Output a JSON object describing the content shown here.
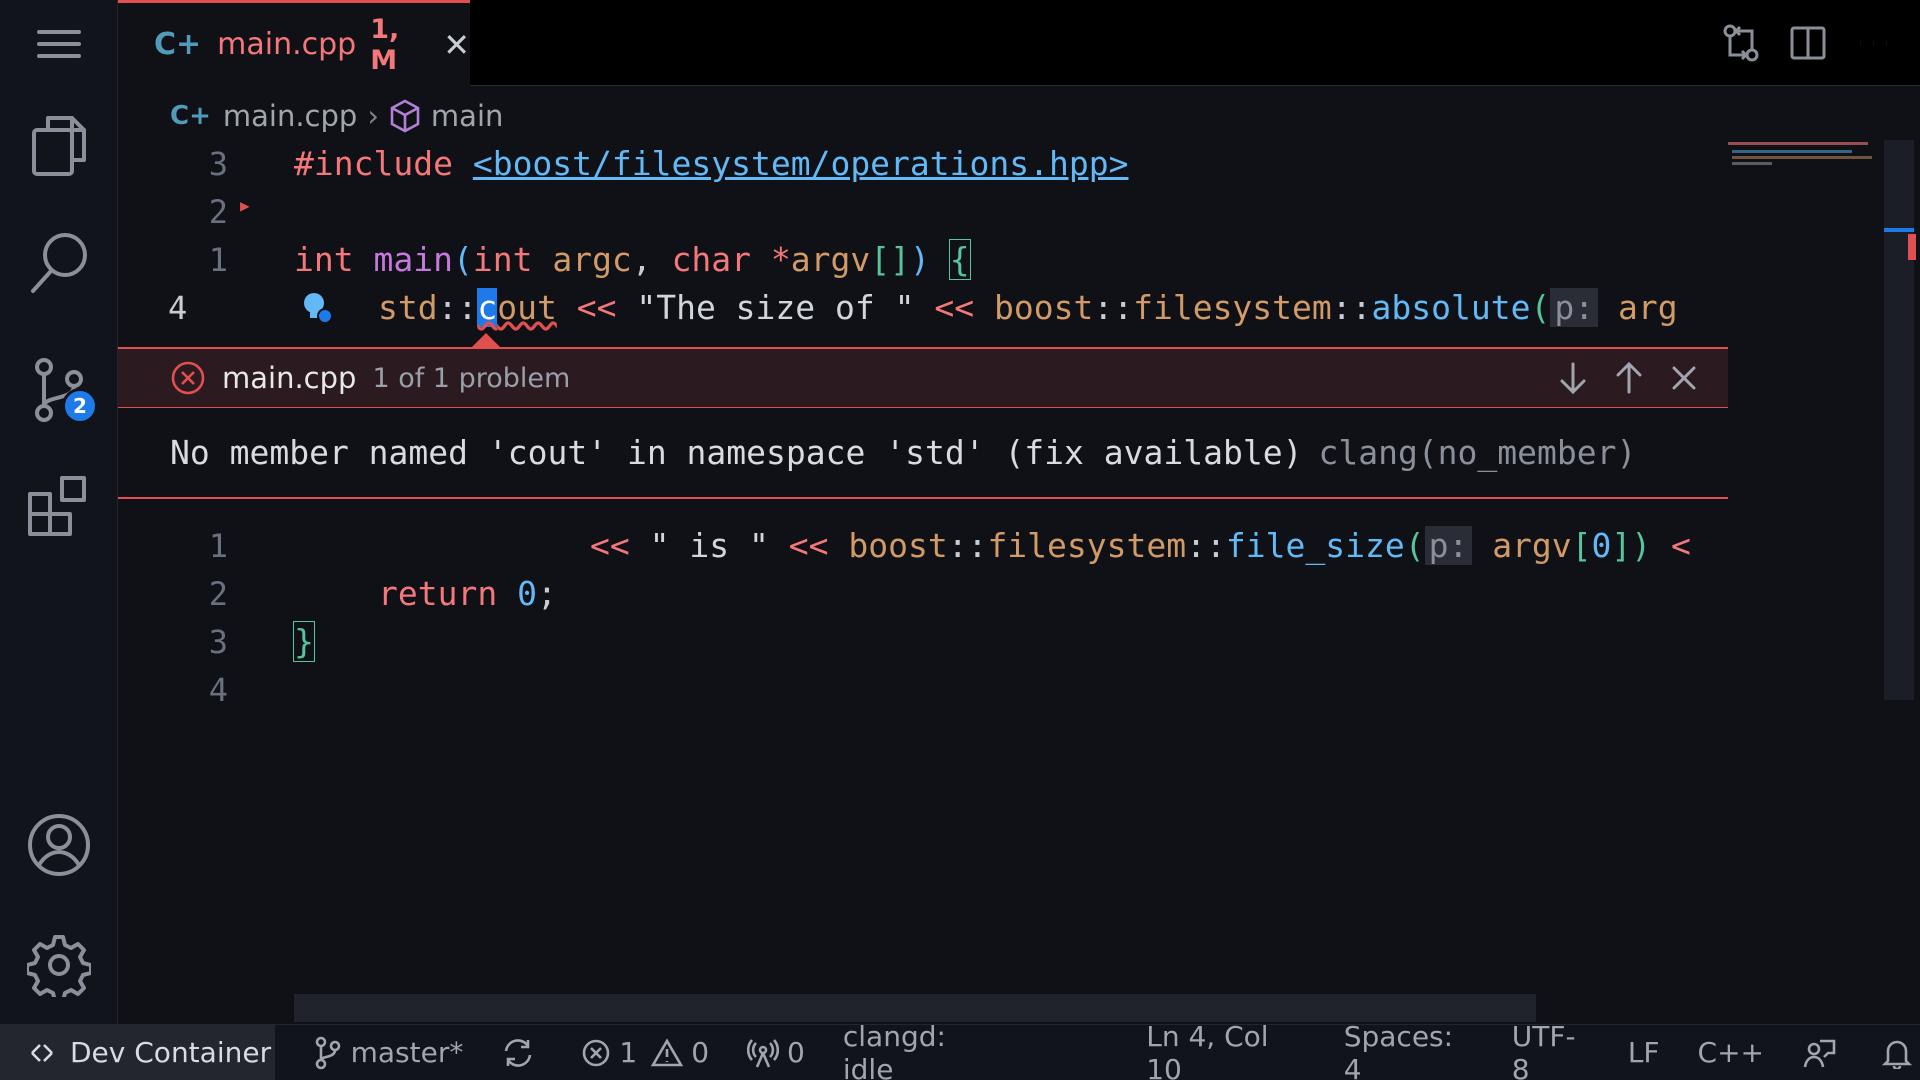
{
  "tab": {
    "icon": "C+",
    "name": "main.cpp",
    "mods": "1, M"
  },
  "breadcrumb": {
    "file": "main.cpp",
    "symbol": "main"
  },
  "gutter": {
    "top": [
      "3",
      "2",
      "1",
      "4"
    ],
    "bottom": [
      "1",
      "2",
      "3",
      "4"
    ]
  },
  "code": {
    "l1_kw": "#include",
    "l1_path": "<boost/filesystem/operations.hpp>",
    "l3_int": "int",
    "l3_main": "main",
    "l3_paren": "(",
    "l3_int2": "int",
    "l3_argc": "argc",
    "l3_comma": ",",
    "l3_char": "char",
    "l3_star": "*",
    "l3_argv": "argv",
    "l3_brk": "[]",
    "l3_close": ")",
    "l3_brace": "{",
    "l4_std": "std",
    "l4_sep1": "::",
    "l4_cout_c": "c",
    "l4_cout_rest": "out",
    "l4_op1": "<<",
    "l4_str": "\"The size of \"",
    "l4_op2": "<<",
    "l4_boost": "boost",
    "l4_sep2": "::",
    "l4_fs": "filesystem",
    "l4_sep3": "::",
    "l4_abs": "absolute",
    "l4_paren": "(",
    "l4_hint": "p:",
    "l4_arg": "arg",
    "b1_op1": "<<",
    "b1_str": "\" is \"",
    "b1_op2": "<<",
    "b1_boost": "boost",
    "b1_sep1": "::",
    "b1_fs": "filesystem",
    "b1_sep2": "::",
    "b1_size": "file_size",
    "b1_paren": "(",
    "b1_hint": "p:",
    "b1_argv": "argv",
    "b1_idx_o": "[",
    "b1_zero": "0",
    "b1_idx_c": "])",
    "b1_op3": "<",
    "b2_ret": "return",
    "b2_zero": "0",
    "b2_semi": ";",
    "b3_brace": "}"
  },
  "problem": {
    "file": "main.cpp",
    "count": "1 of 1 problem",
    "message": "No member named 'cout' in namespace 'std' (fix available)",
    "source": "clang(no_member)"
  },
  "activity": {
    "scm_badge": "2"
  },
  "status": {
    "remote": "Dev Container",
    "branch": "master*",
    "errors": "1",
    "warnings": "0",
    "ports": "0",
    "clangd": "clangd: idle",
    "position": "Ln 4, Col 10",
    "spaces": "Spaces: 4",
    "encoding": "UTF-8",
    "eol": "LF",
    "language": "C++"
  },
  "colors": {
    "accent": "#1d7ae8",
    "error": "#e0504f",
    "tab_text": "#f4777a"
  }
}
